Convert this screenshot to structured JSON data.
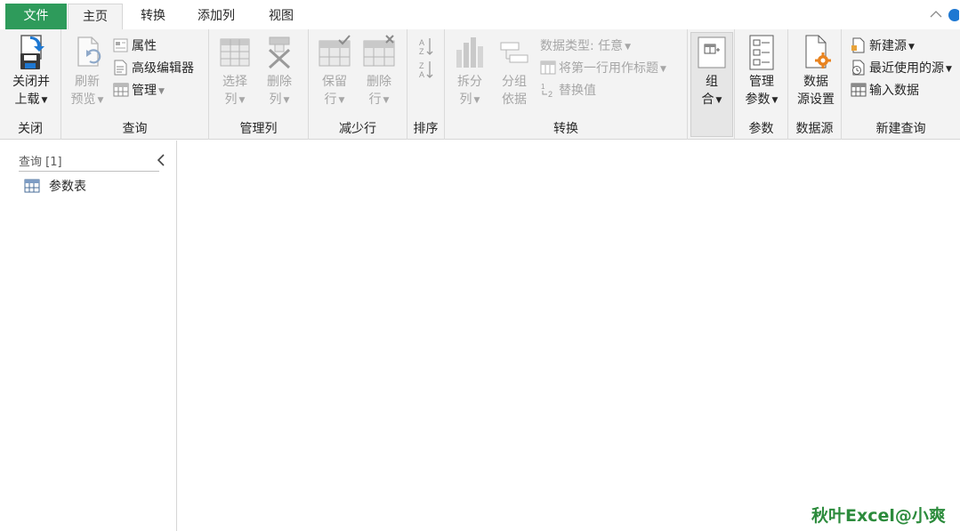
{
  "tabs": {
    "file": "文件",
    "home": "主页",
    "transform": "转换",
    "add_column": "添加列",
    "view": "视图"
  },
  "window_controls": {
    "collapse": "^"
  },
  "ribbon": {
    "close": {
      "label": "关闭",
      "close_load_line1": "关闭并",
      "close_load_line2": "上载"
    },
    "query": {
      "label": "查询",
      "refresh_line1": "刷新",
      "refresh_line2": "预览",
      "properties": "属性",
      "advanced_editor": "高级编辑器",
      "manage": "管理"
    },
    "manage_columns": {
      "label": "管理列",
      "choose_line1": "选择",
      "choose_line2": "列",
      "remove_line1": "删除",
      "remove_line2": "列"
    },
    "reduce_rows": {
      "label": "减少行",
      "keep_line1": "保留",
      "keep_line2": "行",
      "remove_line1": "删除",
      "remove_line2": "行"
    },
    "sort": {
      "label": "排序"
    },
    "transform": {
      "label": "转换",
      "split_line1": "拆分",
      "split_line2": "列",
      "group_line1": "分组",
      "group_line2": "依据",
      "data_type": "数据类型: 任意",
      "first_row_header": "将第一行用作标题",
      "replace_values": "替换值"
    },
    "combine": {
      "combine_line1": "组",
      "combine_line2": "合"
    },
    "parameters": {
      "label": "参数",
      "manage_line1": "管理",
      "manage_line2": "参数"
    },
    "data_sources": {
      "label": "数据源",
      "settings_line1": "数据",
      "settings_line2": "源设置"
    },
    "new_query": {
      "label": "新建查询",
      "new_source": "新建源",
      "recent_sources": "最近使用的源",
      "enter_data": "输入数据"
    }
  },
  "queries_pane": {
    "header": "查询 [1]",
    "items": [
      {
        "name": "参数表"
      }
    ]
  },
  "watermark": "秋叶Excel@小爽",
  "colors": {
    "file_tab": "#2e9b5b",
    "ribbon_bg": "#f3f3f3",
    "accent_orange": "#e8831f",
    "watermark": "#2c8b3c"
  }
}
